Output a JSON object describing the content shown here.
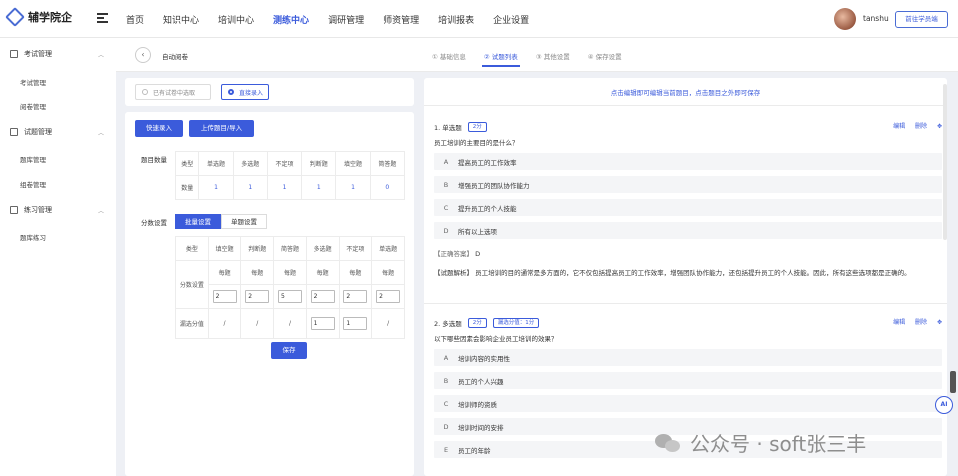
{
  "app": {
    "name": "辅学院企",
    "username": "tanshu",
    "front_label": "前往学员端"
  },
  "nav": [
    "首页",
    "知识中心",
    "培训中心",
    "测练中心",
    "调研管理",
    "师资管理",
    "培训报表",
    "企业设置"
  ],
  "nav_active": 3,
  "sidebar": {
    "groups": [
      {
        "label": "考试管理",
        "items": [
          "考试管理",
          "阅卷管理"
        ]
      },
      {
        "label": "试题管理",
        "items": [
          "题库管理",
          "组卷管理"
        ]
      },
      {
        "label": "练习管理",
        "items": [
          "题库练习"
        ]
      }
    ]
  },
  "breadcrumb": {
    "title": "自动阅卷"
  },
  "steps": [
    "① 基础信息",
    "② 试题列表",
    "③ 其他设置",
    "④ 保存设置"
  ],
  "steps_active": 1,
  "source": {
    "option_a": "已有试卷中选取",
    "option_b": "直接录入"
  },
  "buttons": {
    "quick_entry": "快速录入",
    "upload": "上传题目/导入",
    "save": "保存"
  },
  "count_table": {
    "label": "题目数量",
    "headers": [
      "类型",
      "单选题",
      "多选题",
      "不定项",
      "判断题",
      "填空题",
      "简答题"
    ],
    "row_label": "数量",
    "values": [
      "1",
      "1",
      "1",
      "1",
      "1",
      "0"
    ]
  },
  "score": {
    "label": "分数设置",
    "tabs": [
      "批量设置",
      "单题设置"
    ],
    "headers": [
      "类型",
      "填空题",
      "判断题",
      "简答题",
      "多选题",
      "不定项",
      "单选题"
    ],
    "row1_label": "分数设置",
    "per_label": "每题",
    "inputs": [
      "2",
      "2",
      "5",
      "2",
      "2",
      "2"
    ],
    "row2_label": "漏选分值",
    "missed": [
      "/",
      "/",
      "/",
      "1",
      "1",
      "/"
    ]
  },
  "hint": "点击编辑即可编辑当前题目，点击题目之外即可保存",
  "actions": {
    "edit": "编辑",
    "delete": "删除"
  },
  "q1": {
    "no": "1. 单选题",
    "score": "2分",
    "text": "员工培训的主要目的是什么？",
    "options": [
      {
        "k": "A",
        "t": "提高员工的工作效率"
      },
      {
        "k": "B",
        "t": "增强员工的团队协作能力"
      },
      {
        "k": "C",
        "t": "提升员工的个人技能"
      },
      {
        "k": "D",
        "t": "所有以上选项"
      }
    ],
    "answer_label": "【正确答案】",
    "answer": "D",
    "analysis_label": "【试题解析】",
    "analysis": "员工培训的目的通常是多方面的，它不仅包括提高员工的工作效率，增强团队协作能力，还包括提升员工的个人技能。因此，所有这些选项都是正确的。"
  },
  "q2": {
    "no": "2. 多选题",
    "score": "2分",
    "missed": "漏选分值：1分",
    "text": "以下哪些因素会影响企业员工培训的效果？",
    "options": [
      {
        "k": "A",
        "t": "培训内容的实用性"
      },
      {
        "k": "B",
        "t": "员工的个人兴趣"
      },
      {
        "k": "C",
        "t": "培训师的资质"
      },
      {
        "k": "D",
        "t": "培训时间的安排"
      },
      {
        "k": "E",
        "t": "员工的年龄"
      }
    ]
  },
  "watermark": "公众号 · soft张三丰",
  "ai_badge": "AI",
  "colors": {
    "accent": "#3b5bdb",
    "bg": "#eef0f5"
  }
}
